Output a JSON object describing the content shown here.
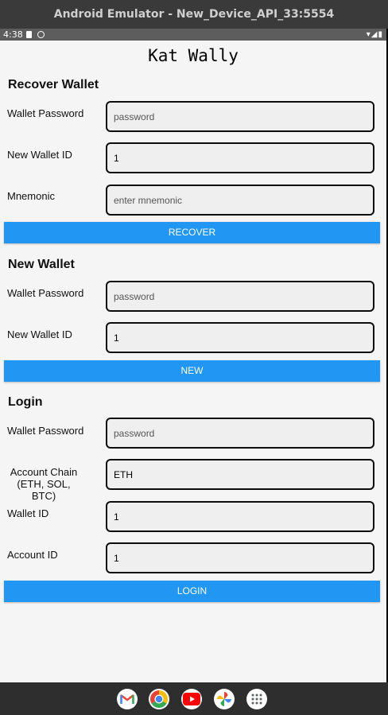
{
  "window": {
    "title": "Android Emulator - New_Device_API_33:5554"
  },
  "status_bar": {
    "time": "4:38",
    "right_icons": "▾◢▮"
  },
  "app": {
    "title": "Kat Wally"
  },
  "recover_wallet": {
    "heading": "Recover Wallet",
    "password_label": "Wallet Password",
    "password_placeholder": "password",
    "wallet_id_label": "New Wallet ID",
    "wallet_id_value": "1",
    "mnemonic_label": "Mnemonic",
    "mnemonic_placeholder": "enter mnemonic",
    "button_label": "RECOVER"
  },
  "new_wallet": {
    "heading": "New Wallet",
    "password_label": "Wallet Password",
    "password_placeholder": "password",
    "wallet_id_label": "New Wallet ID",
    "wallet_id_value": "1",
    "button_label": "NEW"
  },
  "login": {
    "heading": "Login",
    "password_label": "Wallet Password",
    "password_placeholder": "password",
    "chain_label_line1": "Account Chain",
    "chain_label_line2": "(ETH, SOL, BTC)",
    "chain_value": "ETH",
    "wallet_id_label": "Wallet ID",
    "wallet_id_value": "1",
    "account_id_label": "Account ID",
    "account_id_value": "1",
    "button_label": "LOGIN"
  },
  "dock": {
    "icons": [
      "gmail-icon",
      "chrome-icon",
      "youtube-icon",
      "photos-icon",
      "app-drawer-icon"
    ]
  },
  "colors": {
    "button": "#2196f3",
    "app_background": "#f5f5f5",
    "field_border": "#0d0d0d"
  }
}
